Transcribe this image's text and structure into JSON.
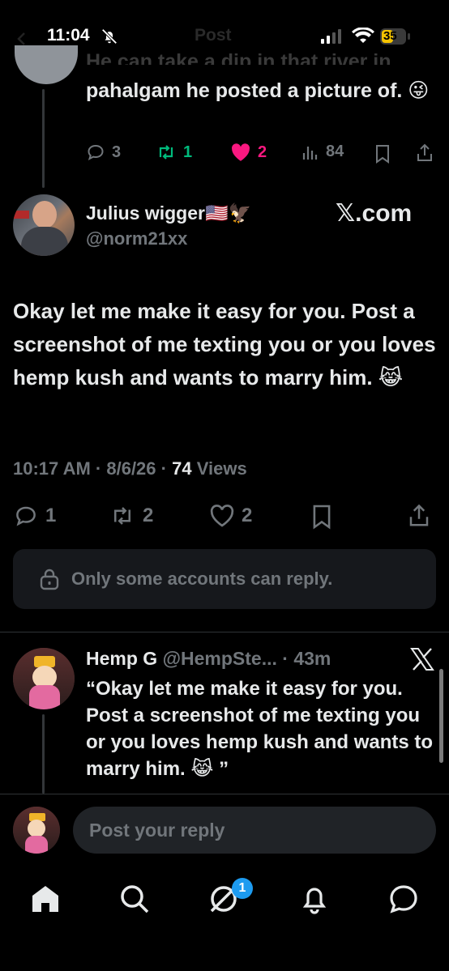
{
  "status_bar": {
    "time": "11:04",
    "title": "Post",
    "battery": "35"
  },
  "parent_tweet": {
    "text_cut": "He can take a dip in that river in",
    "text": "pahalgam he posted a picture of. 😜",
    "replies": "3",
    "reposts": "1",
    "likes": "2",
    "views": "84"
  },
  "main_tweet": {
    "author_name": "Julius wigger🇺🇸🦅",
    "author_handle": "@norm21xx",
    "watermark": "𝕏.com",
    "text": "Okay let me make it easy for you. Post a screenshot of me texting you or you loves hemp kush and wants to marry him. 😹",
    "time": "10:17 AM",
    "date": "8/6/26",
    "views_count": "74",
    "views_label": "Views",
    "replies": "1",
    "reposts": "2",
    "likes": "2"
  },
  "reply_restriction": "Only some accounts can reply.",
  "reply_tweet": {
    "author_name": "Hemp G",
    "author_handle": "@HempSte...",
    "age": "43m",
    "text": "“Okay let me make it easy for you. Post a screenshot of me texting you or you loves hemp kush and wants to marry him. 😹 ”"
  },
  "composer": {
    "placeholder": "Post your reply"
  },
  "tab_bar": {
    "notification_badge": "1"
  },
  "colors": {
    "accent_blue": "#1d9bf0",
    "repost_green": "#00ba7c",
    "like_pink": "#f91880",
    "muted": "#71767b"
  }
}
